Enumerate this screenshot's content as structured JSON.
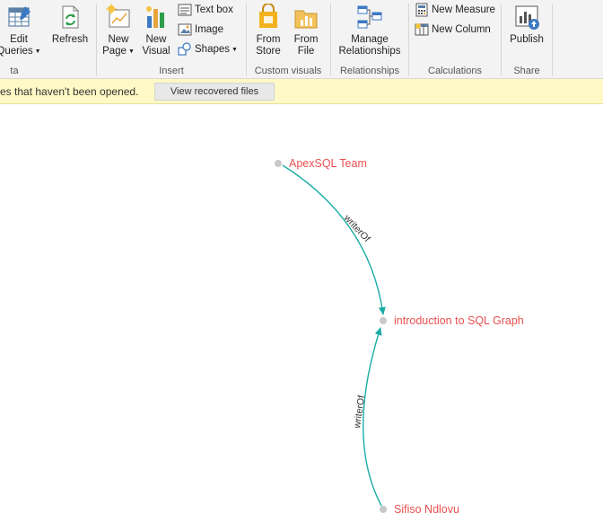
{
  "ribbon": {
    "groups": {
      "external_data": {
        "label": "ta"
      },
      "insert": {
        "label": "Insert"
      },
      "custom_visuals": {
        "label": "Custom visuals"
      },
      "relationships": {
        "label": "Relationships"
      },
      "calculations": {
        "label": "Calculations"
      },
      "share": {
        "label": "Share"
      }
    },
    "buttons": {
      "edit_queries": {
        "line1": "Edit",
        "line2": "Queries"
      },
      "refresh": {
        "line1": "Refresh"
      },
      "new_page": {
        "line1": "New",
        "line2": "Page"
      },
      "new_visual": {
        "line1": "New",
        "line2": "Visual"
      },
      "text_box": {
        "label": "Text box"
      },
      "image": {
        "label": "Image"
      },
      "shapes": {
        "label": "Shapes"
      },
      "from_store": {
        "line1": "From",
        "line2": "Store"
      },
      "from_file": {
        "line1": "From",
        "line2": "File"
      },
      "manage_relationships": {
        "line1": "Manage",
        "line2": "Relationships"
      },
      "new_measure": {
        "label": "New Measure"
      },
      "new_column": {
        "label": "New Column"
      },
      "publish": {
        "line1": "Publish"
      }
    }
  },
  "notice": {
    "text": "es that haven't been opened.",
    "button": "View recovered files"
  },
  "graph": {
    "nodes": [
      {
        "id": "apexsql",
        "label": "ApexSQL Team"
      },
      {
        "id": "intro",
        "label": "introduction to SQL Graph"
      },
      {
        "id": "sifiso",
        "label": "Sifiso Ndlovu"
      }
    ],
    "edges": [
      {
        "from": "apexsql",
        "to": "intro",
        "label": "writerOf"
      },
      {
        "from": "sifiso",
        "to": "intro",
        "label": "writerOf"
      }
    ],
    "colors": {
      "node": "#c8c8c8",
      "label": "#e8514f",
      "edge": "#1aada6"
    }
  }
}
